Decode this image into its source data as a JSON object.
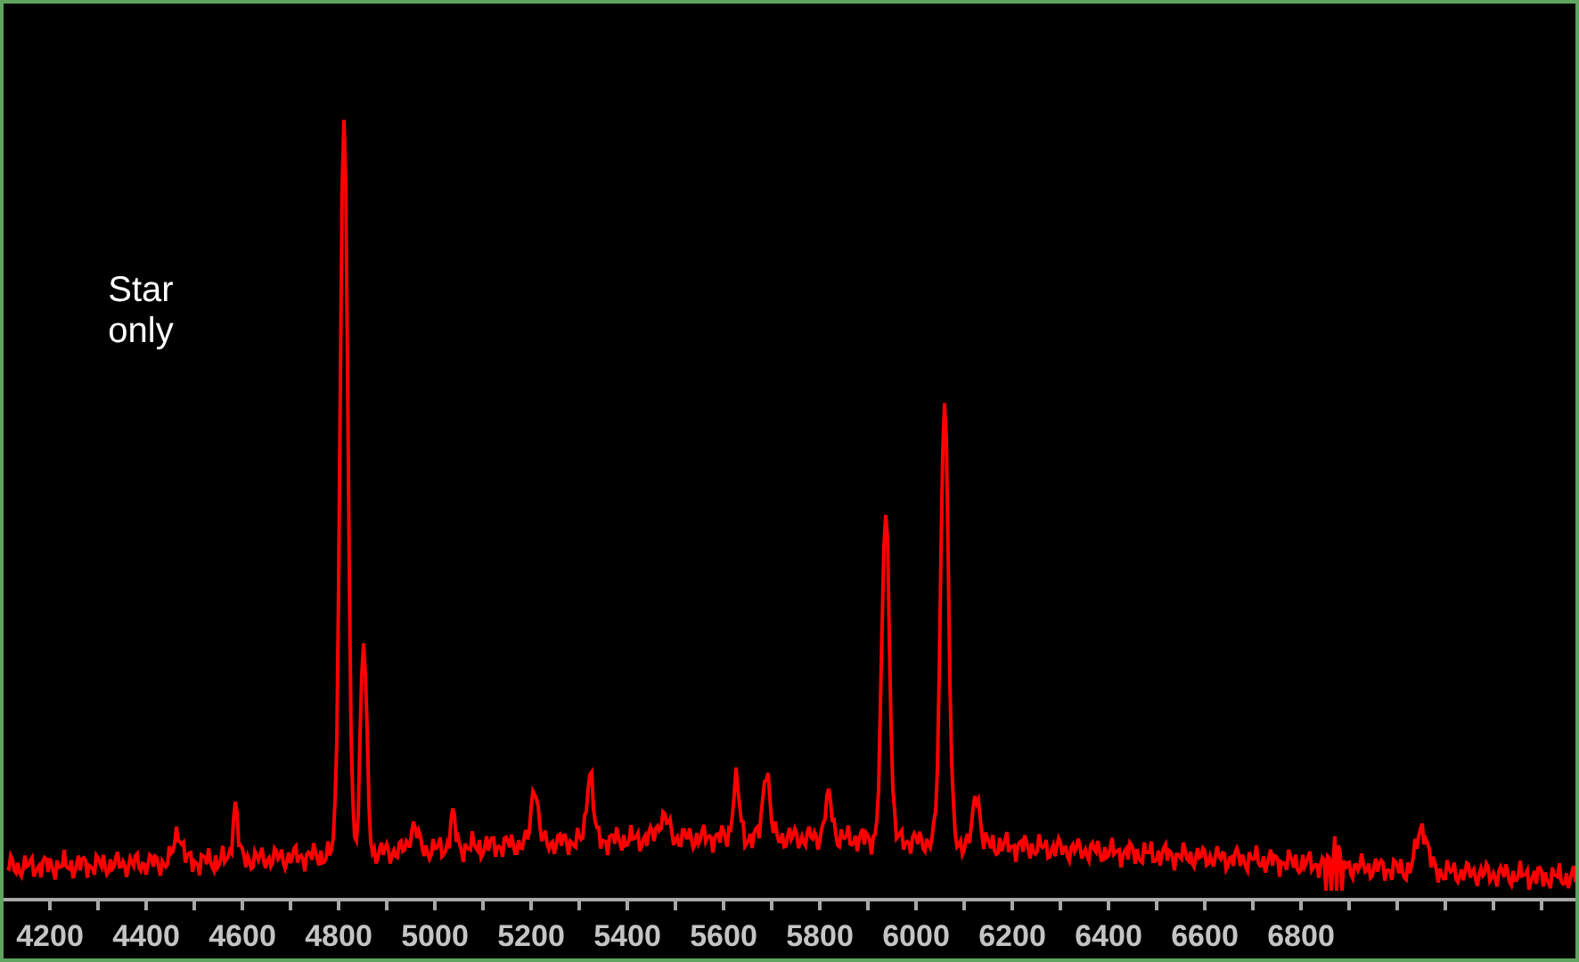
{
  "annotation": "Star only",
  "x_axis": {
    "tick_labels": [
      "4200",
      "4400",
      "4600",
      "4800",
      "5000",
      "5200",
      "5400",
      "5600",
      "5800",
      "6000",
      "6200",
      "6400",
      "6600",
      "6800"
    ]
  }
}
